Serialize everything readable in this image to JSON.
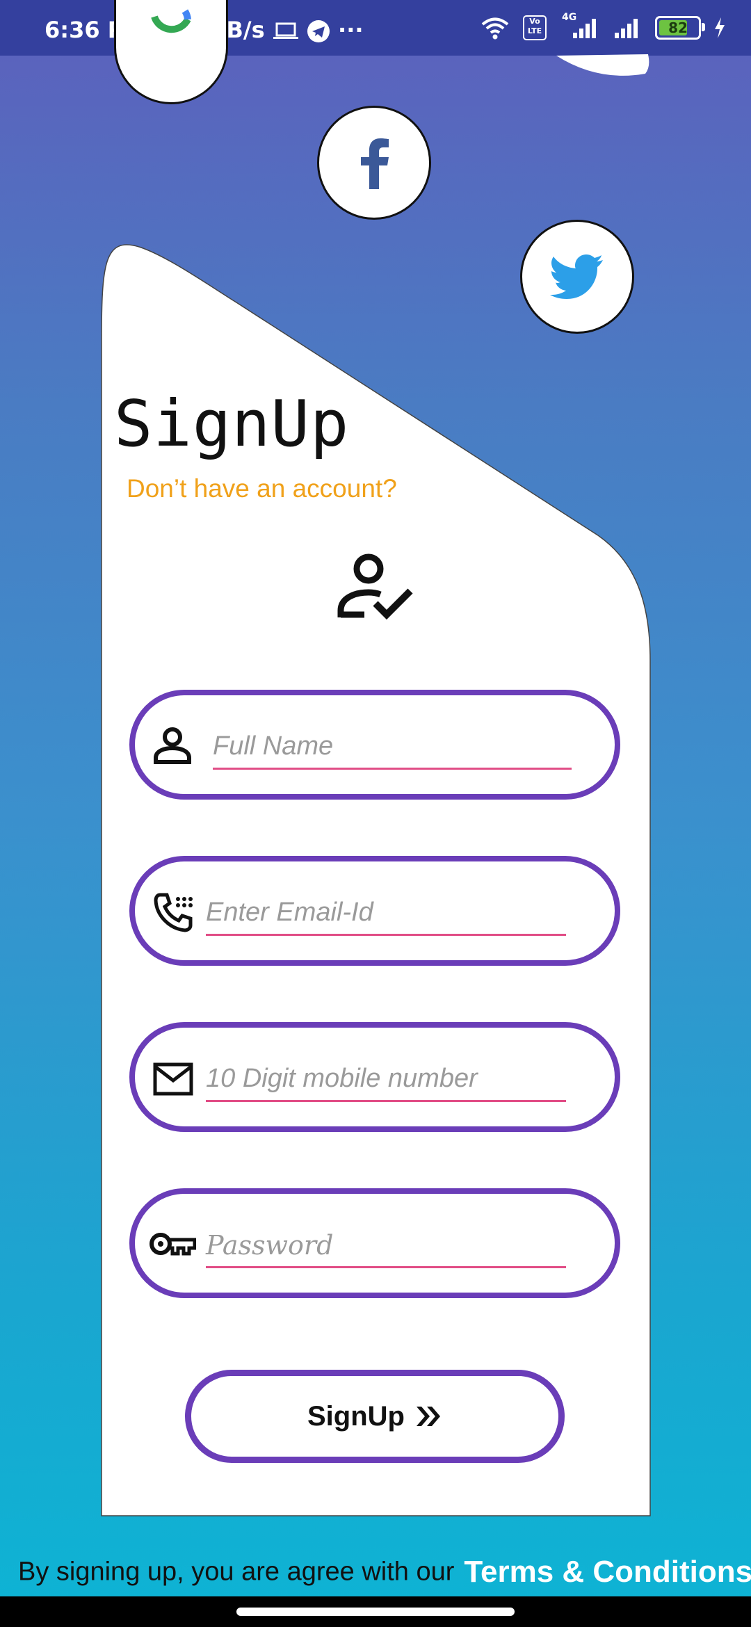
{
  "status_bar": {
    "time_speed": "6:36 PM | 3.1KB/s",
    "volte": "Vo LTE",
    "network": "4G",
    "battery": "82"
  },
  "social": [
    "google-icon",
    "facebook-icon",
    "twitter-icon"
  ],
  "form": {
    "title": "SignUp",
    "subtitle": "Don’t have an account?",
    "fields": [
      {
        "placeholder": "Full Name",
        "icon": "person-icon"
      },
      {
        "placeholder": "Enter Email-Id",
        "icon": "phone-dialpad-icon"
      },
      {
        "placeholder": "10 Digit mobile number",
        "icon": "mail-icon"
      },
      {
        "placeholder": "Password",
        "icon": "key-icon"
      }
    ],
    "submit_label": "SignUp",
    "submit_icon": "double-chevron-right-icon"
  },
  "footer": {
    "text": "By signing up, you are agree with our",
    "link": "Terms & Conditions"
  },
  "colors": {
    "accent_purple": "#6a3db8",
    "subtitle_orange": "#f0a11a",
    "underline_pink": "#e14d86",
    "status_bar": "#34409e"
  }
}
